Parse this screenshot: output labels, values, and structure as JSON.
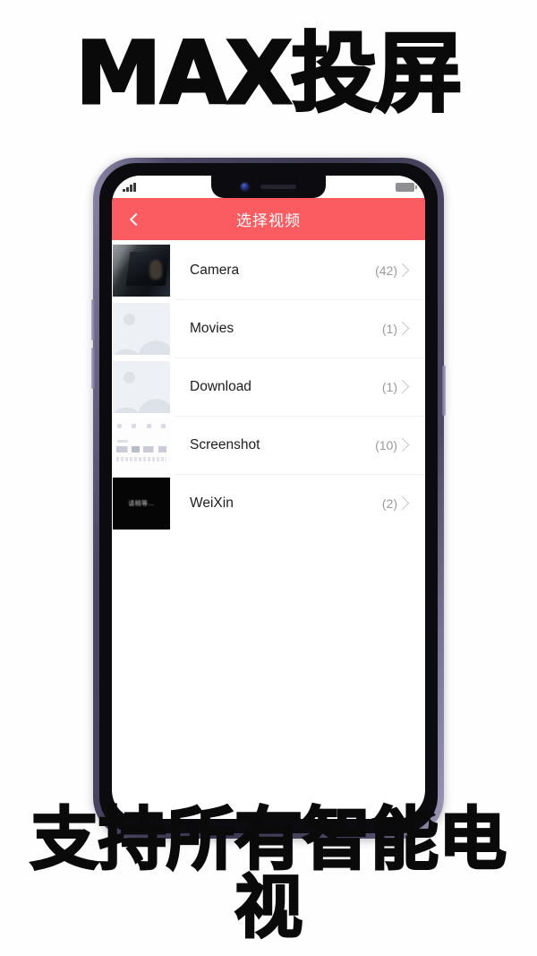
{
  "promo": {
    "top_headline": "MAX投屏",
    "bottom_headline": "支持所有智能电视"
  },
  "theme": {
    "accent": "#fa5c61",
    "frame": "#4b4763",
    "screen_bg": "#ffffff"
  },
  "phone": {
    "statusbar": {
      "signal_icon": "signal-bars-icon",
      "battery_icon": "battery-icon"
    },
    "notch": {
      "camera_icon": "front-camera-icon",
      "speaker_icon": "earpiece-speaker-icon"
    }
  },
  "app": {
    "header": {
      "back_icon": "back-chevron-icon",
      "title": "选择视频"
    },
    "folders": [
      {
        "name": "Camera",
        "count": "(42)",
        "thumb": "car-photo-thumbnail"
      },
      {
        "name": "Movies",
        "count": "(1)",
        "thumb": "image-placeholder-thumbnail"
      },
      {
        "name": "Download",
        "count": "(1)",
        "thumb": "image-placeholder-thumbnail"
      },
      {
        "name": "Screenshot",
        "count": "(10)",
        "thumb": "screenshot-capture-thumbnail"
      },
      {
        "name": "WeiXin",
        "count": "(2)",
        "thumb": "black-video-thumbnail",
        "thumb_text": "请稍等…"
      }
    ]
  }
}
